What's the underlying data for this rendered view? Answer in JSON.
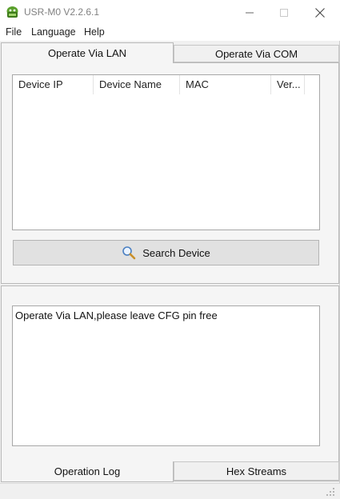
{
  "window": {
    "title": "USR-M0 V2.2.6.1"
  },
  "menu": {
    "file": "File",
    "language": "Language",
    "help": "Help"
  },
  "tabs": {
    "lan": "Operate Via LAN",
    "com": "Operate Via COM"
  },
  "device_table": {
    "columns": [
      "Device IP",
      "Device Name",
      "MAC",
      "Ver..."
    ],
    "rows": []
  },
  "search_button": {
    "label": "Search Device",
    "icon": "magnifier-icon"
  },
  "log": {
    "text": "Operate Via LAN,please leave CFG pin free"
  },
  "bottom_tabs": {
    "operation_log": "Operation Log",
    "hex_streams": "Hex Streams"
  }
}
